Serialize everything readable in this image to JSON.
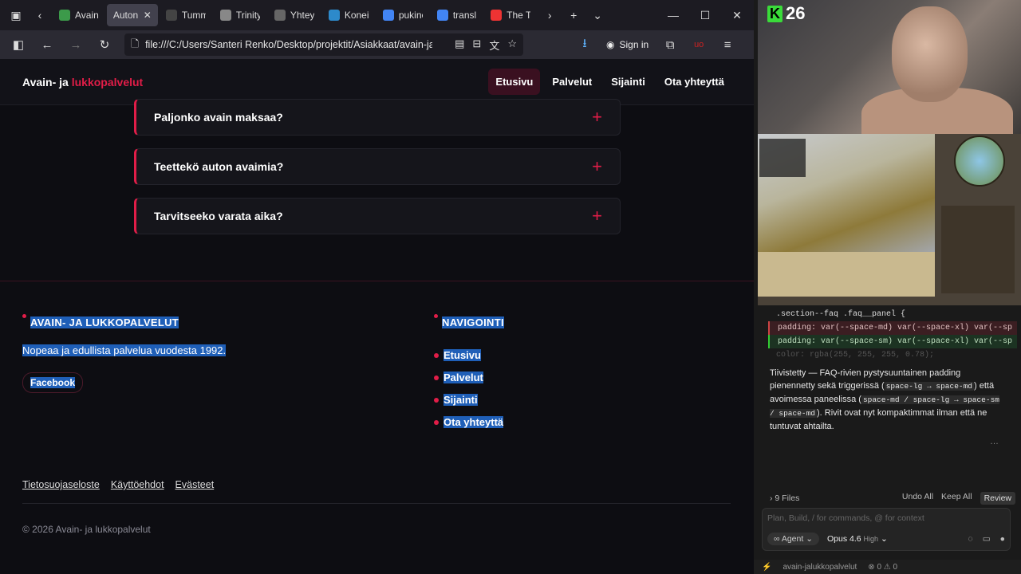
{
  "browser": {
    "tabs": [
      {
        "label": "Avain",
        "color": "#3c9a4a",
        "active": false
      },
      {
        "label": "Auton a",
        "color": "#444",
        "active": true
      },
      {
        "label": "Tumma Sc",
        "color": "#444",
        "active": false
      },
      {
        "label": "Trinity",
        "color": "#888",
        "active": false
      },
      {
        "label": "Yhteys",
        "color": "#666",
        "active": false
      },
      {
        "label": "Konei",
        "color": "#2d8acb",
        "active": false
      },
      {
        "label": "pukine",
        "color": "#4285f4",
        "active": false
      },
      {
        "label": "transl",
        "color": "#4285f4",
        "active": false
      },
      {
        "label": "The T",
        "color": "#e33",
        "active": false
      }
    ],
    "url": "file:///C:/Users/Santeri Renko/Desktop/projektit/Asiakkaat/avain-jaluk",
    "sign_in": "Sign in"
  },
  "site": {
    "logo_main": "Avain- ja ",
    "logo_accent": "lukkopalvelut",
    "nav": [
      "Etusivu",
      "Palvelut",
      "Sijainti",
      "Ota yhteyttä"
    ],
    "faq": [
      "Paljonko avain maksaa?",
      "Teettekö auton avaimia?",
      "Tarvitseeko varata aika?"
    ],
    "footer": {
      "brand_title": "AVAIN- JA LUKKOPALVELUT",
      "brand_desc": "Nopeaa ja edullista palvelua vuodesta 1992.",
      "facebook": "Facebook",
      "nav_title": "NAVIGOINTI",
      "nav_links": [
        "Etusivu",
        "Palvelut",
        "Sijainti",
        "Ota yhteyttä"
      ],
      "legal": [
        "Tietosuojaseloste",
        "Käyttöehdot",
        "Evästeet"
      ],
      "copyright": "© 2026 Avain- ja lukkopalvelut"
    }
  },
  "stream": {
    "counter": "26",
    "counter_badge": "K"
  },
  "editor": {
    "code_lines": [
      {
        "text": ".section--faq .faq__panel {",
        "kind": "plain"
      },
      {
        "text": "padding: var(--space-md) var(--space-xl) var(--sp",
        "kind": "del"
      },
      {
        "text": "padding: var(--space-sm) var(--space-xl) var(--sp",
        "kind": "add"
      },
      {
        "text": "color: rgba(255, 255, 255, 0.78);",
        "kind": "faded"
      }
    ],
    "message_pre": "Tiivistetty — FAQ-rivien pystysuuntainen padding pienennetty sekä triggerissä (",
    "message_code1": "space-lg → space-md",
    "message_mid": ") että avoimessa paneelissa (",
    "message_code2": "space-md / space-lg → space-sm / space-md",
    "message_post": "). Rivit ovat nyt kompaktimmat ilman että ne tuntuvat ahtailta.",
    "files": "9 Files",
    "undo_all": "Undo All",
    "keep_all": "Keep All",
    "review": "Review",
    "placeholder": "Plan, Build, / for commands, @ for context",
    "agent": "Agent",
    "model": "Opus 4.6",
    "model_mode": "High",
    "status_project": "avain-jalukkopalvelut",
    "status_counts": "⊗ 0 ⚠ 0"
  }
}
